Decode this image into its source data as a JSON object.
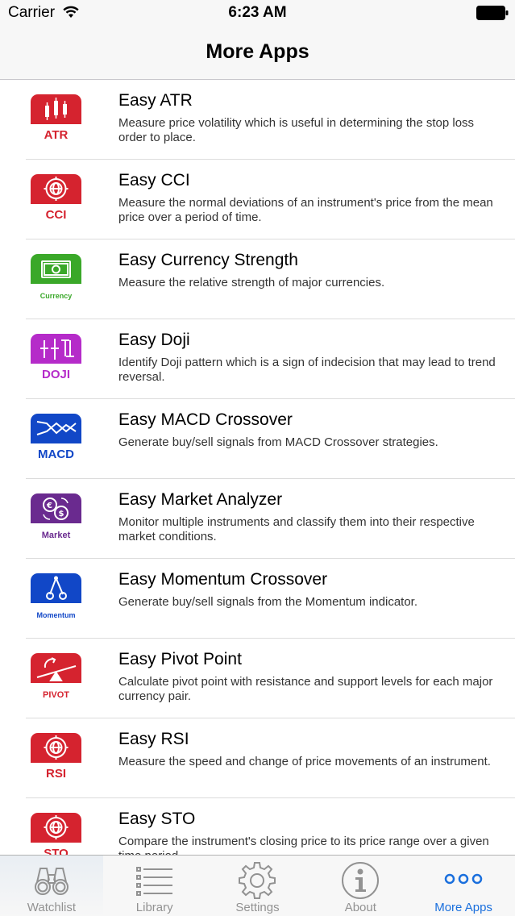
{
  "status_bar": {
    "carrier": "Carrier",
    "time": "6:23 AM"
  },
  "nav": {
    "title": "More Apps"
  },
  "apps": [
    {
      "name": "Easy ATR",
      "description": "Measure price volatility which is useful in determining the stop loss order to place.",
      "icon_label": "ATR",
      "icon": "candlestick-icon",
      "color": "#d5232f"
    },
    {
      "name": "Easy CCI",
      "description": "Measure the normal deviations of an instrument's price from the mean price over a period of time.",
      "icon_label": "CCI",
      "icon": "target-globe-icon",
      "color": "#d5232f"
    },
    {
      "name": "Easy Currency Strength",
      "description": "Measure the relative strength of major currencies.",
      "icon_label": "Currency",
      "icon": "banknote-icon",
      "color": "#3aa829"
    },
    {
      "name": "Easy Doji",
      "description": "Identify Doji pattern which is a sign of indecision that may lead to trend reversal.",
      "icon_label": "DOJI",
      "icon": "doji-candles-icon",
      "color": "#b52bc9"
    },
    {
      "name": "Easy MACD Crossover",
      "description": "Generate buy/sell signals from MACD Crossover strategies.",
      "icon_label": "MACD",
      "icon": "crossover-lines-icon",
      "color": "#1147c7"
    },
    {
      "name": "Easy Market Analyzer",
      "description": "Monitor multiple instruments and classify them into their respective market conditions.",
      "icon_label": "Market",
      "icon": "currency-exchange-icon",
      "color": "#6a2a8f"
    },
    {
      "name": "Easy Momentum Crossover",
      "description": "Generate buy/sell signals from the Momentum indicator.",
      "icon_label": "Momentum",
      "icon": "pendulum-icon",
      "color": "#1147c7"
    },
    {
      "name": "Easy Pivot Point",
      "description": "Calculate pivot point with resistance and support levels for each major currency pair.",
      "icon_label": "PIVOT",
      "icon": "seesaw-icon",
      "color": "#d5232f"
    },
    {
      "name": "Easy RSI",
      "description": "Measure the speed and change of price movements of an instrument.",
      "icon_label": "RSI",
      "icon": "target-globe-icon",
      "color": "#d5232f"
    },
    {
      "name": "Easy STO",
      "description": "Compare the instrument's closing price to its price range over a given time period.",
      "icon_label": "STO",
      "icon": "target-globe-icon",
      "color": "#d5232f"
    }
  ],
  "tabs": [
    {
      "label": "Watchlist",
      "icon": "binoculars-icon",
      "active": false
    },
    {
      "label": "Library",
      "icon": "list-icon",
      "active": false
    },
    {
      "label": "Settings",
      "icon": "gear-icon",
      "active": false
    },
    {
      "label": "About",
      "icon": "info-icon",
      "active": false
    },
    {
      "label": "More Apps",
      "icon": "more-dots-icon",
      "active": true
    }
  ],
  "colors": {
    "tab_active": "#1a6fdd",
    "tab_inactive": "#929292"
  }
}
